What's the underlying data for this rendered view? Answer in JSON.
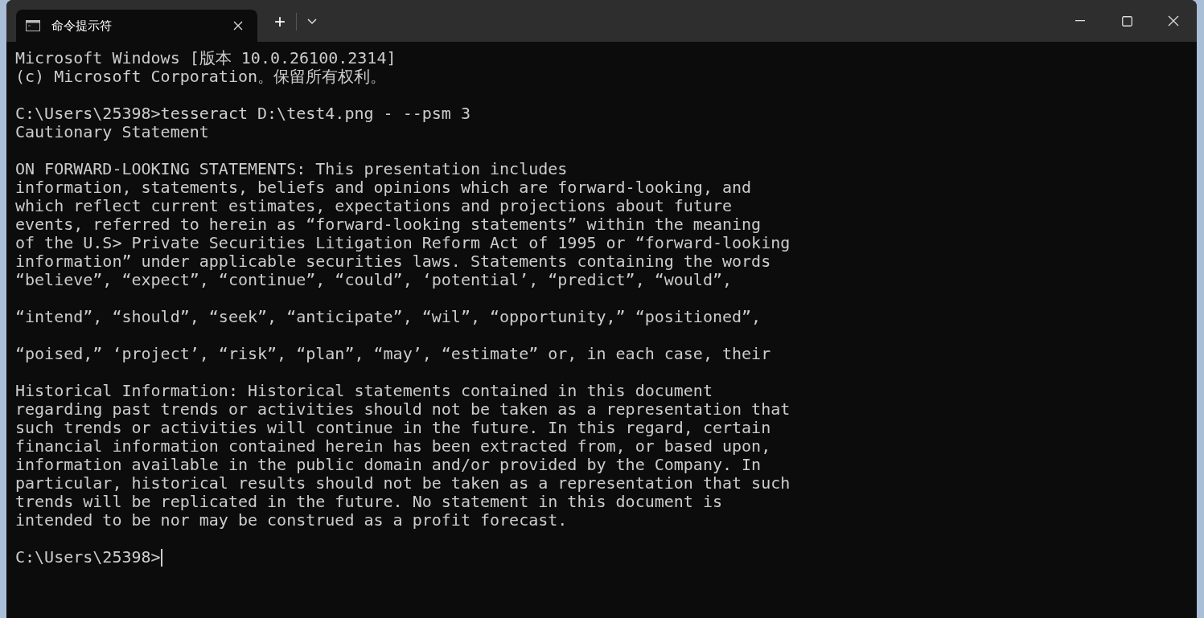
{
  "window": {
    "tabs": [
      {
        "title": "命令提示符",
        "selected": true
      }
    ],
    "new_tab": "+"
  },
  "console": {
    "blocks": [
      {
        "lines": [
          "Microsoft Windows [版本 10.0.26100.2314]",
          "(c) Microsoft Corporation。保留所有权利。"
        ]
      },
      {
        "lines": [
          "C:\\Users\\25398>tesseract D:\\test4.png - --psm 3",
          "Cautionary Statement"
        ]
      },
      {
        "lines": [
          "ON FORWARD-LOOKING STATEMENTS: This presentation includes",
          "information, statements, beliefs and opinions which are forward-looking, and",
          "which reflect current estimates, expectations and projections about future",
          "events, referred to herein as “forward-looking statements” within the meaning",
          "of the U.S> Private Securities Litigation Reform Act of 1995 or “forward-looking",
          "information” under applicable securities laws. Statements containing the words",
          "“believe”, “expect”, “continue”, “could”, ‘potential’, “predict”, “would”,"
        ]
      },
      {
        "lines": [
          "“intend”, “should”, “seek”, “anticipate”, “wil”, “opportunity,” “positioned”,"
        ]
      },
      {
        "lines": [
          "“poised,” ‘project’, “risk”, “plan”, “may’, “estimate” or, in each case, their"
        ]
      },
      {
        "lines": [
          "Historical Information: Historical statements contained in this document",
          "regarding past trends or activities should not be taken as a representation that",
          "such trends or activities will continue in the future. In this regard, certain",
          "financial information contained herein has been extracted from, or based upon,",
          "information available in the public domain and/or provided by the Company. In",
          "particular, historical results should not be taken as a representation that such",
          "trends will be replicated in the future. No statement in this document is",
          "intended to be nor may be construed as a profit forecast."
        ]
      }
    ],
    "prompt": "C:\\Users\\25398>"
  }
}
